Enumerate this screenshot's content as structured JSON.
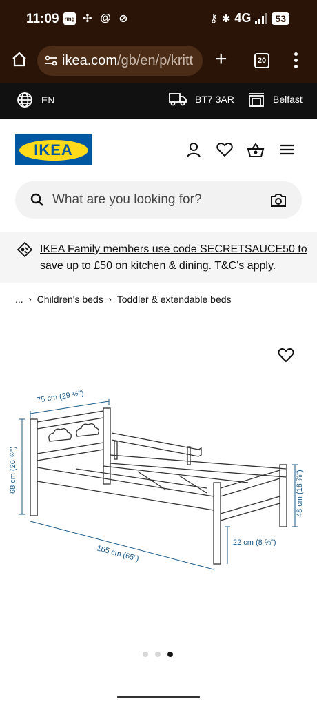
{
  "status_bar": {
    "time": "11:09",
    "notif_icon_labels": [
      "ring"
    ],
    "network": "4G",
    "battery": "53",
    "icons": [
      "ring-app-icon",
      "pinwheel-icon",
      "threads-icon",
      "signal-mute-icon",
      "key-icon",
      "bluetooth-icon",
      "signal-bars-icon",
      "battery-icon"
    ]
  },
  "browser": {
    "url_host": "ikea.com",
    "url_path": "/gb/en/p/kritt",
    "tab_count": "20",
    "icons": [
      "home-icon",
      "site-settings-icon",
      "new-tab-icon",
      "tabs-icon",
      "menu-icon"
    ]
  },
  "utility_bar": {
    "language": "EN",
    "postcode": "BT7 3AR",
    "store": "Belfast"
  },
  "header": {
    "logo_text": "IKEA",
    "icons": [
      "account-icon",
      "wishlist-icon",
      "basket-icon",
      "hamburger-icon"
    ]
  },
  "search": {
    "placeholder": "What are you looking for?"
  },
  "promo": {
    "text": "IKEA Family members use code SECRETSAUCE50 to save up to £50 on kitchen & dining. T&C's apply."
  },
  "breadcrumb": {
    "ellipsis": "...",
    "items": [
      "Children's beds",
      "Toddler & extendable beds"
    ]
  },
  "product_image": {
    "dimensions": {
      "width": "75 cm (29 ½\")",
      "headboard_height": "68 cm (26 ¾\")",
      "length": "165 cm (65\")",
      "footboard_height": "48 cm (18 ⅞\")",
      "clearance": "22 cm (8 ⅝\")"
    },
    "carousel_count": 3,
    "carousel_active": 3
  },
  "colors": {
    "chrome_bg": "#2a1407",
    "utility_bg": "#111111",
    "ikea_blue": "#0058a3",
    "ikea_yellow": "#ffda1a"
  }
}
